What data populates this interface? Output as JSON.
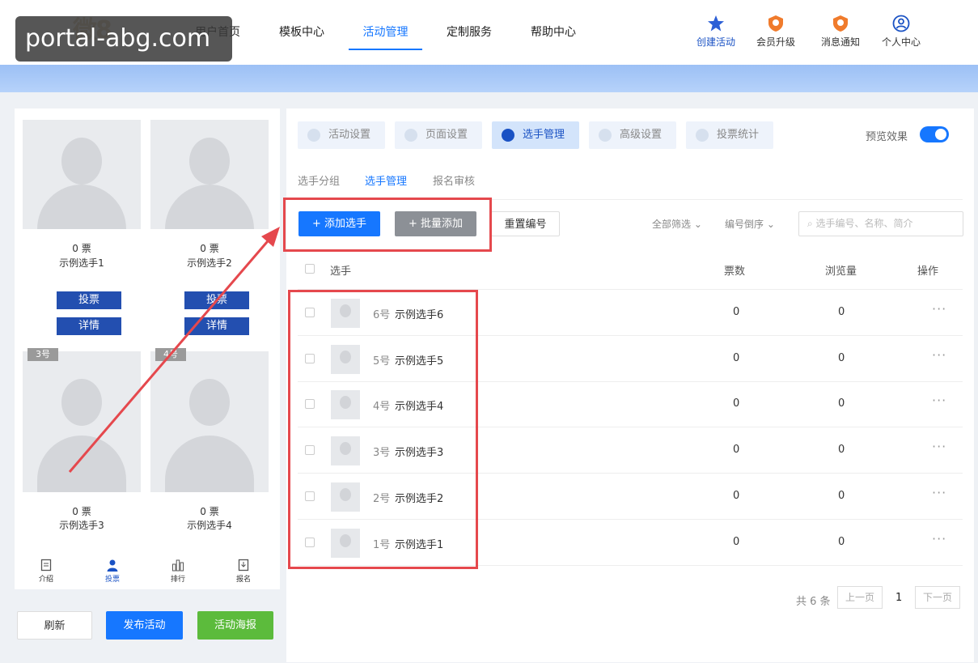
{
  "watermark": "portal-abg.com",
  "logo": "微8",
  "nav": {
    "items": [
      "用户首页",
      "模板中心",
      "活动管理",
      "定制服务",
      "帮助中心"
    ],
    "create": "创建活动",
    "upgrade": "会员升级",
    "messages": "消息通知",
    "profile": "个人中心"
  },
  "preview": {
    "cards": [
      {
        "votes": "0 票",
        "name": "示例选手1",
        "vote_btn": "投票",
        "detail_btn": "详情"
      },
      {
        "votes": "0 票",
        "name": "示例选手2",
        "vote_btn": "投票",
        "detail_btn": "详情"
      },
      {
        "tag": "3号",
        "votes": "0 票",
        "name": "示例选手3"
      },
      {
        "tag": "4号",
        "votes": "0 票",
        "name": "示例选手4"
      }
    ],
    "tabs": [
      "介绍",
      "投票",
      "排行",
      "报名"
    ]
  },
  "actions": {
    "refresh": "刷新",
    "publish": "发布活动",
    "poster": "活动海报"
  },
  "steps": [
    "活动设置",
    "页面设置",
    "选手管理",
    "高级设置",
    "投票统计"
  ],
  "preview_toggle": "预览效果",
  "subtabs": [
    "选手分组",
    "选手管理",
    "报名审核"
  ],
  "toolbar": {
    "add": "+ 添加选手",
    "batch": "+ 批量添加",
    "renumber": "重置编号",
    "filter_all": "全部筛选 ⌄",
    "sort": "编号倒序 ⌄",
    "search_placeholder": "选手编号、名称、简介"
  },
  "table": {
    "headers": {
      "player": "选手",
      "votes": "票数",
      "views": "浏览量",
      "ops": "操作"
    },
    "rows": [
      {
        "num": "6号",
        "name": "示例选手6",
        "votes": "0",
        "views": "0",
        "ops": "···"
      },
      {
        "num": "5号",
        "name": "示例选手5",
        "votes": "0",
        "views": "0",
        "ops": "···"
      },
      {
        "num": "4号",
        "name": "示例选手4",
        "votes": "0",
        "views": "0",
        "ops": "···"
      },
      {
        "num": "3号",
        "name": "示例选手3",
        "votes": "0",
        "views": "0",
        "ops": "···"
      },
      {
        "num": "2号",
        "name": "示例选手2",
        "votes": "0",
        "views": "0",
        "ops": "···"
      },
      {
        "num": "1号",
        "name": "示例选手1",
        "votes": "0",
        "views": "0",
        "ops": "···"
      }
    ]
  },
  "pager": {
    "total": "共 6 条",
    "prev": "上一页",
    "current": "1",
    "next": "下一页"
  },
  "colors": {
    "primary": "#1677ff",
    "dark_blue": "#234fb0",
    "green": "#5cbb3c",
    "annotation": "#e5484d"
  }
}
